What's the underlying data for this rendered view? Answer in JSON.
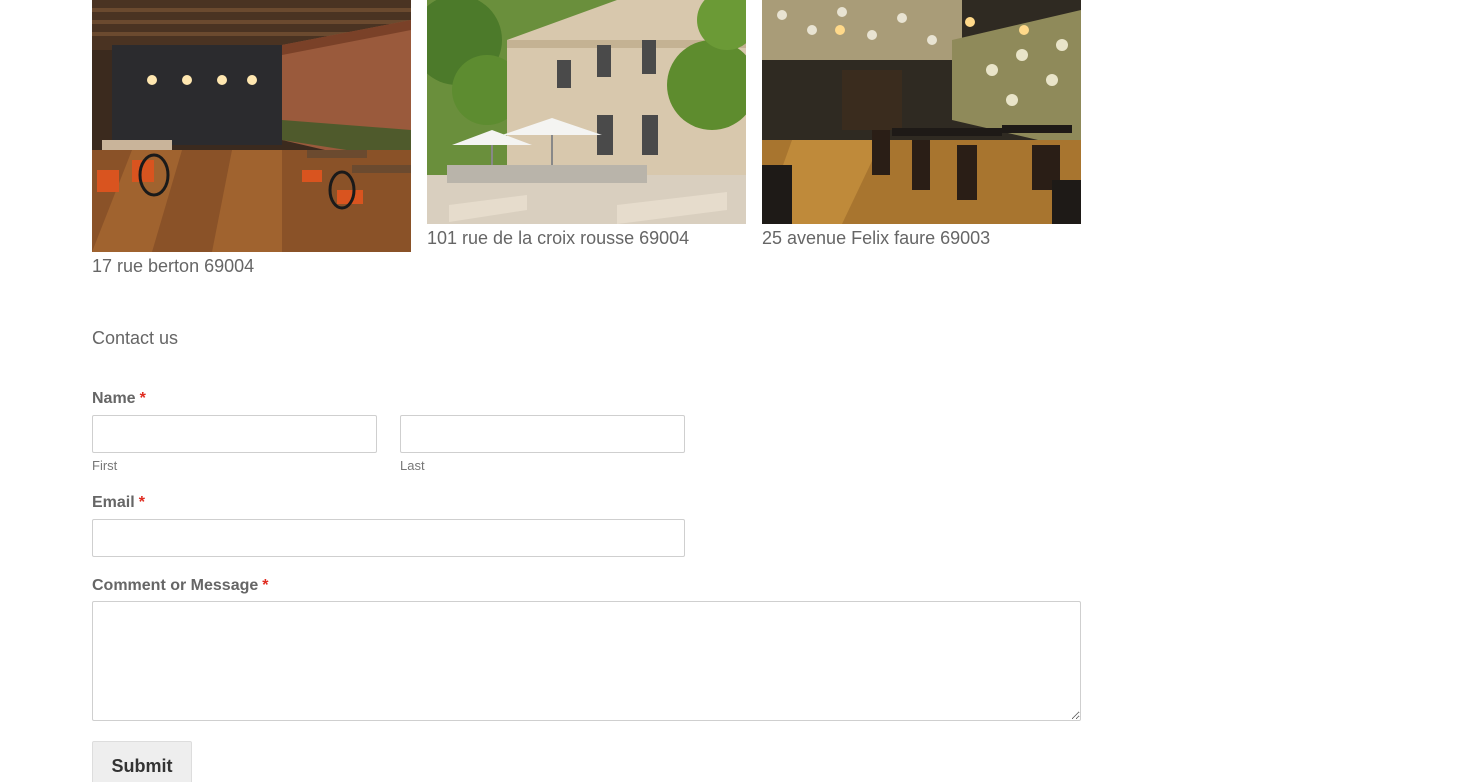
{
  "locations": [
    {
      "image": "restaurant-interior-brick-wall-photo",
      "caption": "17 rue berton 69004"
    },
    {
      "image": "building-terrace-umbrellas-photo",
      "caption": "101 rue de la croix rousse 69004"
    },
    {
      "image": "restaurant-dining-room-photo",
      "caption": "25 avenue Felix faure 69003"
    }
  ],
  "contact": {
    "title": "Contact us",
    "required_marker": "*",
    "name": {
      "label": "Name",
      "first": {
        "value": "",
        "sub_label": "First"
      },
      "last": {
        "value": "",
        "sub_label": "Last"
      }
    },
    "email": {
      "label": "Email",
      "value": ""
    },
    "message": {
      "label": "Comment or Message",
      "value": ""
    },
    "submit_label": "Submit"
  },
  "colors": {
    "text": "#666666",
    "required": "#e02b20",
    "input_border": "#cfcfcf",
    "button_bg": "#eeeeee"
  }
}
